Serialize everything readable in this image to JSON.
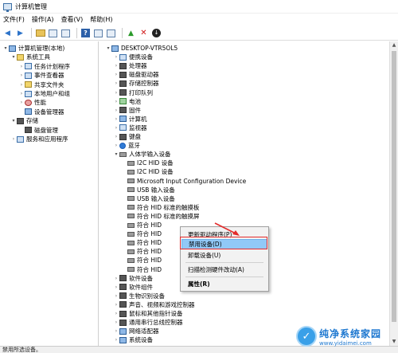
{
  "window": {
    "title": "计算机管理"
  },
  "menu": [
    "文件(F)",
    "操作(A)",
    "查看(V)",
    "帮助(H)"
  ],
  "toolbar_icons": [
    "back-arrow-icon",
    "forward-arrow-icon",
    "up-folder-icon",
    "console-icon",
    "export-icon",
    "help-icon",
    "view-icon",
    "monitor-icon",
    "update-driver-icon",
    "uninstall-x-icon",
    "download-icon"
  ],
  "left_tree": [
    {
      "label": "计算机管理(本地)",
      "level": 0,
      "expander": "▾",
      "icon": "pc"
    },
    {
      "label": "系统工具",
      "level": 1,
      "expander": "▾",
      "icon": "yellow"
    },
    {
      "label": "任务计划程序",
      "level": 2,
      "expander": "›",
      "icon": "blue"
    },
    {
      "label": "事件查看器",
      "level": 2,
      "expander": "›",
      "icon": "blue"
    },
    {
      "label": "共享文件夹",
      "level": 2,
      "expander": "›",
      "icon": "yellow"
    },
    {
      "label": "本地用户和组",
      "level": 2,
      "expander": "›",
      "icon": "blue"
    },
    {
      "label": "性能",
      "level": 2,
      "expander": "›",
      "icon": "red"
    },
    {
      "label": "设备管理器",
      "level": 2,
      "expander": "",
      "icon": "pc"
    },
    {
      "label": "存储",
      "level": 1,
      "expander": "▾",
      "icon": "dark"
    },
    {
      "label": "磁盘管理",
      "level": 2,
      "expander": "",
      "icon": "dark"
    },
    {
      "label": "服务和应用程序",
      "level": 1,
      "expander": "›",
      "icon": "blue"
    }
  ],
  "right_tree": [
    {
      "label": "DESKTOP-VTR5OL5",
      "level": 0,
      "expander": "▾",
      "icon": "pc"
    },
    {
      "label": "便携设备",
      "level": 1,
      "expander": "›",
      "icon": "blue"
    },
    {
      "label": "处理器",
      "level": 1,
      "expander": "›",
      "icon": "dark"
    },
    {
      "label": "磁盘驱动器",
      "level": 1,
      "expander": "›",
      "icon": "dark"
    },
    {
      "label": "存储控制器",
      "level": 1,
      "expander": "›",
      "icon": "dark"
    },
    {
      "label": "打印队列",
      "level": 1,
      "expander": "›",
      "icon": "dark"
    },
    {
      "label": "电池",
      "level": 1,
      "expander": "›",
      "icon": "green"
    },
    {
      "label": "固件",
      "level": 1,
      "expander": "›",
      "icon": "dark"
    },
    {
      "label": "计算机",
      "level": 1,
      "expander": "›",
      "icon": "pc"
    },
    {
      "label": "监视器",
      "level": 1,
      "expander": "›",
      "icon": "blue"
    },
    {
      "label": "键盘",
      "level": 1,
      "expander": "›",
      "icon": "dark"
    },
    {
      "label": "蓝牙",
      "level": 1,
      "expander": "›",
      "icon": "bt"
    },
    {
      "label": "人体学输入设备",
      "level": 1,
      "expander": "▾",
      "icon": "hid"
    },
    {
      "label": "I2C HID 设备",
      "level": 2,
      "expander": "",
      "icon": "hid"
    },
    {
      "label": "I2C HID 设备",
      "level": 2,
      "expander": "",
      "icon": "hid"
    },
    {
      "label": "Microsoft Input Configuration Device",
      "level": 2,
      "expander": "",
      "icon": "hid"
    },
    {
      "label": "USB 输入设备",
      "level": 2,
      "expander": "",
      "icon": "hid"
    },
    {
      "label": "USB 输入设备",
      "level": 2,
      "expander": "",
      "icon": "hid"
    },
    {
      "label": "符合 HID 标准的触摸板",
      "level": 2,
      "expander": "",
      "icon": "hid"
    },
    {
      "label": "符合 HID 标准的触摸屏",
      "level": 2,
      "expander": "",
      "icon": "hid"
    },
    {
      "label": "符合 HID",
      "level": 2,
      "expander": "",
      "icon": "hid"
    },
    {
      "label": "符合 HID",
      "level": 2,
      "expander": "",
      "icon": "hid"
    },
    {
      "label": "符合 HID",
      "level": 2,
      "expander": "",
      "icon": "hid"
    },
    {
      "label": "符合 HID",
      "level": 2,
      "expander": "",
      "icon": "hid"
    },
    {
      "label": "符合 HID",
      "level": 2,
      "expander": "",
      "icon": "hid"
    },
    {
      "label": "符合 HID",
      "level": 2,
      "expander": "",
      "icon": "hid"
    },
    {
      "label": "软件设备",
      "level": 1,
      "expander": "›",
      "icon": "dark"
    },
    {
      "label": "软件组件",
      "level": 1,
      "expander": "›",
      "icon": "dark"
    },
    {
      "label": "生物识别设备",
      "level": 1,
      "expander": "›",
      "icon": "dark"
    },
    {
      "label": "声音、视频和游戏控制器",
      "level": 1,
      "expander": "›",
      "icon": "dark"
    },
    {
      "label": "鼠标和其他指针设备",
      "level": 1,
      "expander": "›",
      "icon": "dark"
    },
    {
      "label": "通用串行总线控制器",
      "level": 1,
      "expander": "›",
      "icon": "dark"
    },
    {
      "label": "网络适配器",
      "level": 1,
      "expander": "›",
      "icon": "pc"
    },
    {
      "label": "系统设备",
      "level": 1,
      "expander": "›",
      "icon": "pc"
    }
  ],
  "context_menu": {
    "update_driver": "更新驱动程序(P)",
    "disable_device": "禁用设备(D)",
    "uninstall_device": "卸载设备(U)",
    "scan_hardware": "扫描检测硬件改动(A)",
    "properties": "属性(R)"
  },
  "status": {
    "text": "禁用所选设备。"
  },
  "watermark": {
    "title": "纯净系统家园",
    "url": "www.yidaimei.com",
    "accent": "#1e78d0"
  }
}
